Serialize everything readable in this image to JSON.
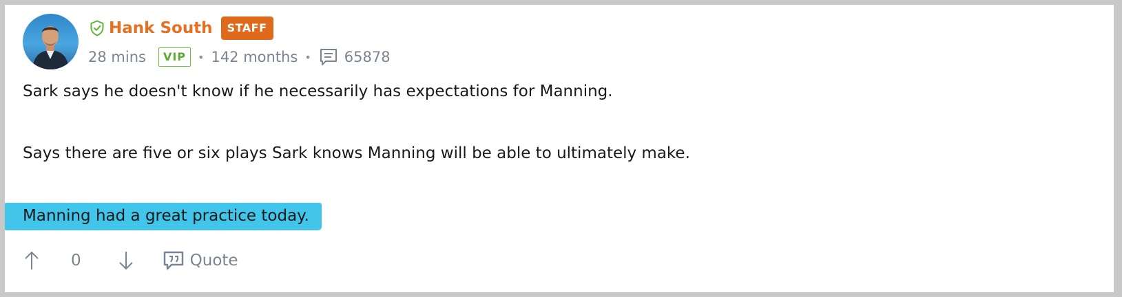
{
  "post": {
    "author": {
      "name": "Hank South",
      "role_badge": "STAFF",
      "avatar_icon": "user-avatar",
      "verified_icon": "shield-check-icon",
      "name_color": "#e5701f"
    },
    "meta": {
      "time_ago": "28 mins",
      "vip_badge": "VIP",
      "membership": "142 months",
      "comments_icon": "comments-icon",
      "post_count": "65878"
    },
    "body": {
      "paragraphs": [
        "Sark says he doesn't know if he necessarily has expectations for Manning.",
        "Says there are five or six plays Sark knows Manning will be able to ultimately make.",
        "Manning had a great practice today."
      ],
      "highlight_color": "#41c5eb"
    },
    "actions": {
      "upvote_icon": "arrow-up-icon",
      "vote_count": "0",
      "downvote_icon": "arrow-down-icon",
      "quote_icon": "quote-icon",
      "quote_label": "Quote"
    }
  }
}
